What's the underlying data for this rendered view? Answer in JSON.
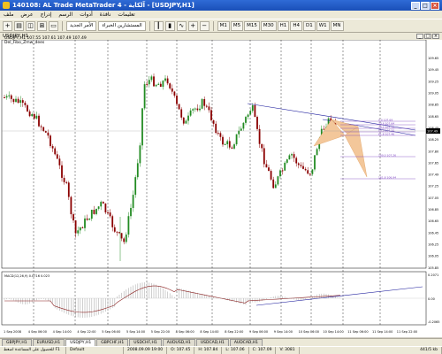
{
  "window": {
    "title": "140108: AL Trade MetaTrader 4 - آلكاية - [USDJPY,H1]"
  },
  "menu": [
    "ملف",
    "عرض",
    "إدراج",
    "الرسم",
    "أدوات",
    "نافذة",
    "تعليمات"
  ],
  "toolbar": {
    "new_order": "الأمر الجديد",
    "experts": "المستشارين الخبراء",
    "timeframes": [
      "M1",
      "M5",
      "M15",
      "M30",
      "H1",
      "H4",
      "D1",
      "W1",
      "MN"
    ]
  },
  "child_window": {
    "title": "USDJPY,H1"
  },
  "chart_info": {
    "symbol_line": "USDJPY,H1 107.55 107.61 107.49 107.49",
    "indicator_name": "Del_Fibo_Zmw_dees"
  },
  "osc_label": "MACD(12,26,9) 0.0716 0.023",
  "colors": {
    "bull": "#228b22",
    "bear": "#8b0000",
    "trend": "#1c1c9c",
    "fib": "#7a3fbf",
    "pattern": "#f3c79a",
    "histogram": "#b0b0b0",
    "signal": "#8b2020"
  },
  "chart_data": {
    "type": "candlestick",
    "symbol": "USDJPY",
    "timeframe": "H1",
    "y_ticks": [
      "109.65",
      "109.45",
      "109.25",
      "109.05",
      "108.85",
      "108.65",
      "108.45",
      "108.25",
      "107.80",
      "107.65",
      "107.49",
      "107.25",
      "107.05",
      "106.85",
      "106.65",
      "106.45",
      "106.25",
      "106.05",
      "105.85"
    ],
    "x_ticks": [
      "1 Sep 2008",
      "4 Sep 06:00",
      "4 Sep 14:00",
      "4 Sep 22:00",
      "5 Sep 06:00",
      "5 Sep 14:00",
      "5 Sep 22:00",
      "8 Sep 06:00",
      "8 Sep 14:00",
      "8 Sep 22:00",
      "9 Sep 06:00",
      "9 Sep 14:00",
      "10 Sep 06:00",
      "10 Sep 14:00",
      "11 Sep 06:00",
      "11 Sep 14:00",
      "11 Sep 22:00"
    ],
    "current_price": "107.49",
    "fib_levels": [
      "0.0 107.69",
      "23.6 107.64",
      "38.2 107.58",
      "50.0 107.50",
      "61.8 107.46",
      "100.0 107.26",
      "161.8 106.94"
    ],
    "osc_ticks": [
      "0.2071",
      "0.00",
      "-0.2065"
    ]
  },
  "tabs": [
    "GBPJPY,H1",
    "EURUSD,H1",
    "USDJPY,H1",
    "GBPCHF,H1",
    "USDCHF,H1",
    "AUDUSD,H1",
    "USDCAD,H1",
    "AUDCAD,H1"
  ],
  "status": {
    "help": "للحصول على المساعدة اضغط F1",
    "profile": "Default",
    "datetime": "2008.09.09 19:00",
    "open": "O: 107.45",
    "high": "H: 107.84",
    "low": "L: 107.06",
    "close": "C: 107.09",
    "volume": "V: 3081",
    "traffic": "441/5 kb"
  }
}
